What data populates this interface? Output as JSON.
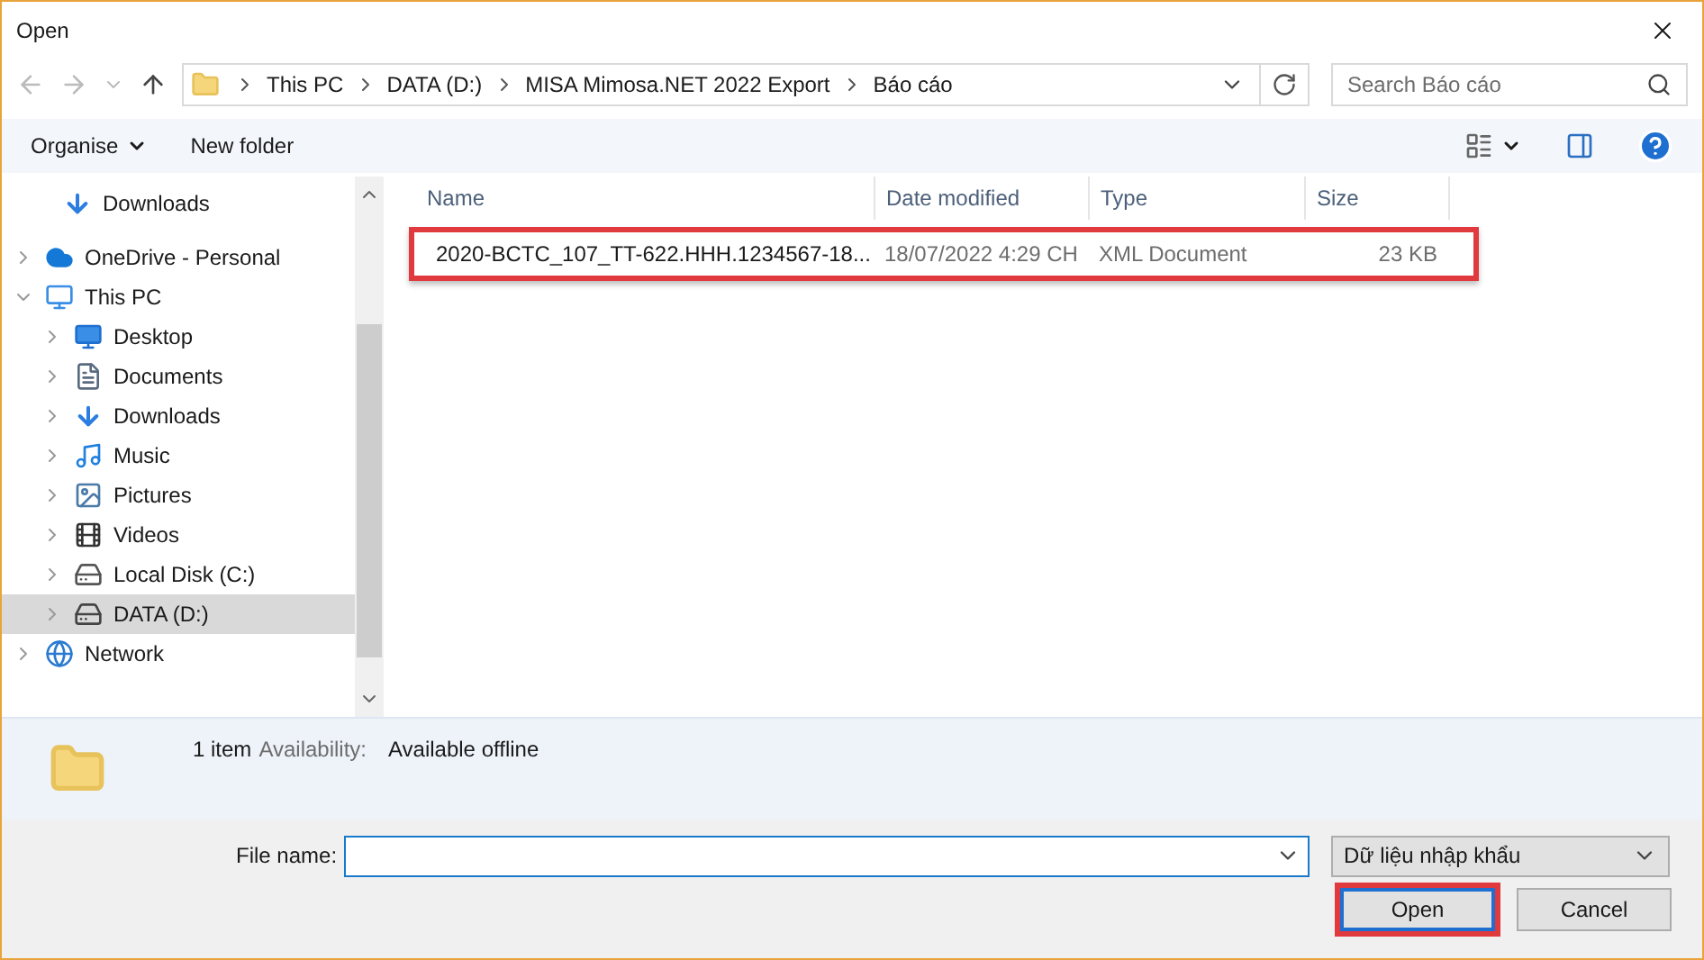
{
  "window": {
    "title": "Open"
  },
  "address": {
    "crumbs": [
      "This PC",
      "DATA (D:)",
      "MISA Mimosa.NET 2022 Export",
      "Báo cáo"
    ]
  },
  "search": {
    "placeholder": "Search Báo cáo"
  },
  "toolbar": {
    "organise": "Organise",
    "new_folder": "New folder"
  },
  "sidebar": {
    "quick_access_items": [
      {
        "label": "Downloads",
        "kind": "downloads"
      }
    ],
    "tree": [
      {
        "label": "OneDrive - Personal",
        "kind": "cloud",
        "expanded": false,
        "selected": false
      },
      {
        "label": "This PC",
        "kind": "pc",
        "expanded": true,
        "selected": false,
        "children": [
          {
            "label": "Desktop",
            "kind": "desktop",
            "expanded": false,
            "selected": false
          },
          {
            "label": "Documents",
            "kind": "documents",
            "expanded": false,
            "selected": false
          },
          {
            "label": "Downloads",
            "kind": "downloads",
            "expanded": false,
            "selected": false
          },
          {
            "label": "Music",
            "kind": "music",
            "expanded": false,
            "selected": false
          },
          {
            "label": "Pictures",
            "kind": "pictures",
            "expanded": false,
            "selected": false
          },
          {
            "label": "Videos",
            "kind": "videos",
            "expanded": false,
            "selected": false
          },
          {
            "label": "Local Disk (C:)",
            "kind": "disk",
            "expanded": false,
            "selected": false
          },
          {
            "label": "DATA (D:)",
            "kind": "drive",
            "expanded": false,
            "selected": true
          }
        ]
      },
      {
        "label": "Network",
        "kind": "network",
        "expanded": false,
        "selected": false
      }
    ]
  },
  "table": {
    "columns": [
      "Name",
      "Date modified",
      "Type",
      "Size"
    ],
    "rows": [
      {
        "name": "2020-BCTC_107_TT-622.HHH.1234567-18...",
        "date": "18/07/2022 4:29 CH",
        "type": "XML Document",
        "size": "23 KB"
      }
    ]
  },
  "details": {
    "count": "1 item",
    "availability_label": "Availability:",
    "availability_value": "Available offline"
  },
  "bottom": {
    "file_name_label": "File name:",
    "file_type": "Dữ liệu nhập khẩu",
    "buttons": [
      "Open",
      "Cancel"
    ]
  }
}
